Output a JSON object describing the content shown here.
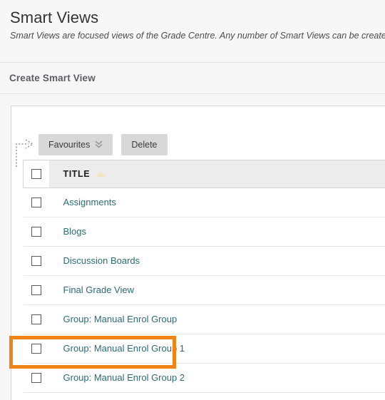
{
  "header": {
    "title": "Smart Views",
    "subtitle": "Smart Views are focused views of the Grade Centre. Any number of Smart Views can be created"
  },
  "action_bar": {
    "create_label": "Create Smart View"
  },
  "toolbar": {
    "favourites_label": "Favourites",
    "favourites_chevron_icon": "chevron-double-down-icon",
    "delete_label": "Delete",
    "selection_pointer_icon": "dotted-arrow-right-icon"
  },
  "table": {
    "select_all_checkbox_name": "select-all-checkbox",
    "columns": [
      {
        "key": "check",
        "label": ""
      },
      {
        "key": "title",
        "label": "TITLE",
        "sort_icon": "sort-ascending-triangle-icon",
        "sorted": "ascending"
      }
    ],
    "rows": [
      {
        "title": "Assignments"
      },
      {
        "title": "Blogs"
      },
      {
        "title": "Discussion Boards"
      },
      {
        "title": "Final Grade View"
      },
      {
        "title": "Group: Manual Enrol Group"
      },
      {
        "title": "Group: Manual Enrol Group 1"
      },
      {
        "title": "Group: Manual Enrol Group 2"
      }
    ]
  },
  "annotation": {
    "highlight_color": "#f08316",
    "highlighted_row_title": "Group: Manual Enrol Group 1"
  },
  "colors": {
    "page_background": "#f7f7f7",
    "panel_background": "#ffffff",
    "link": "#2a6c75",
    "button_background": "#d8d8d8",
    "table_header_background": "#ececec",
    "border": "#d5d5d5",
    "highlight_orange": "#f08316",
    "sort_triangle": "#f3e5c0"
  }
}
